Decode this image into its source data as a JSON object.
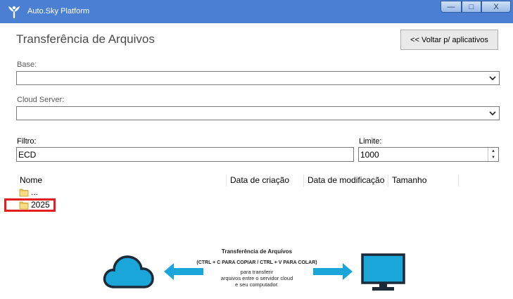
{
  "window": {
    "title": "Auto.Sky Platform",
    "min_glyph": "—",
    "max_glyph": "□",
    "close_glyph": "X",
    "titlebar_color": "#4a7fd4"
  },
  "page": {
    "title": "Transferência de Arquivos",
    "back_button": "<< Voltar p/ aplicativos"
  },
  "form": {
    "base_label": "Base:",
    "base_value": "",
    "cloud_label": "Cloud Server:",
    "cloud_value": "",
    "filter_label": "Filtro:",
    "filter_value": "ECD",
    "limit_label": "Limite:",
    "limit_value": "1000"
  },
  "list": {
    "columns": [
      "Nome",
      "Data de criação",
      "Data de modificação",
      "Tamanho"
    ],
    "rows": [
      {
        "name": "..."
      },
      {
        "name": "2025"
      }
    ]
  },
  "banner": {
    "title": "Transferência de Arquivos",
    "shortcut": "(CTRL + C PARA COPIAR / CTRL + V PARA COLAR)",
    "line1": "para transferir",
    "line2": "arquivos entre o servidor cloud",
    "line3": "e seu computador.",
    "accent_color": "#1ba6d9"
  },
  "highlight_color": "#e41f1f"
}
